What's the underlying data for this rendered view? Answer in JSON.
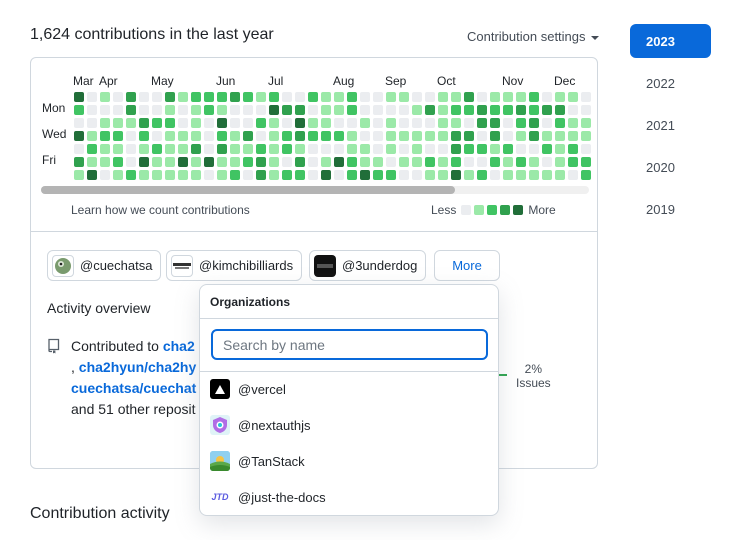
{
  "header": {
    "contributions_heading": "1,624 contributions in the last year",
    "settings_label": "Contribution settings"
  },
  "graph": {
    "months": [
      "Mar",
      "Apr",
      "May",
      "Jun",
      "Jul",
      "Aug",
      "Sep",
      "Oct",
      "Nov",
      "Dec"
    ],
    "days": [
      "Mon",
      "Wed",
      "Fri"
    ],
    "learn_link": "Learn how we count contributions",
    "legend_less": "Less",
    "legend_more": "More",
    "levels": [
      "#ebedf0",
      "#9be9a8",
      "#40c463",
      "#30a14e",
      "#216e39"
    ]
  },
  "orgs": [
    {
      "name": "@cuechatsa"
    },
    {
      "name": "@kimchibilliards"
    },
    {
      "name": "@3underdog"
    }
  ],
  "more_button": "More",
  "activity": {
    "title": "Activity overview",
    "contributed_to": "Contributed to ",
    "repo1": "cha2",
    "comma": ", ",
    "repo2": "cha2hyun/cha2hy",
    "repo3": "cuechatsa/cuechat",
    "others": "and 51 other reposit",
    "issues_pct": "2%",
    "issues_label": "Issues"
  },
  "contribution_activity_heading": "Contribution activity",
  "years": [
    "2023",
    "2022",
    "2021",
    "2020",
    "2019"
  ],
  "dropdown": {
    "title": "Organizations",
    "search_placeholder": "Search by name",
    "items": [
      {
        "name": "@vercel",
        "icon": "vercel-icon"
      },
      {
        "name": "@nextauthjs",
        "icon": "nextauthjs-icon"
      },
      {
        "name": "@TanStack",
        "icon": "tanstack-icon"
      },
      {
        "name": "@just-the-docs",
        "icon": "just-the-docs-icon",
        "icon_text": "JTD"
      }
    ]
  }
}
